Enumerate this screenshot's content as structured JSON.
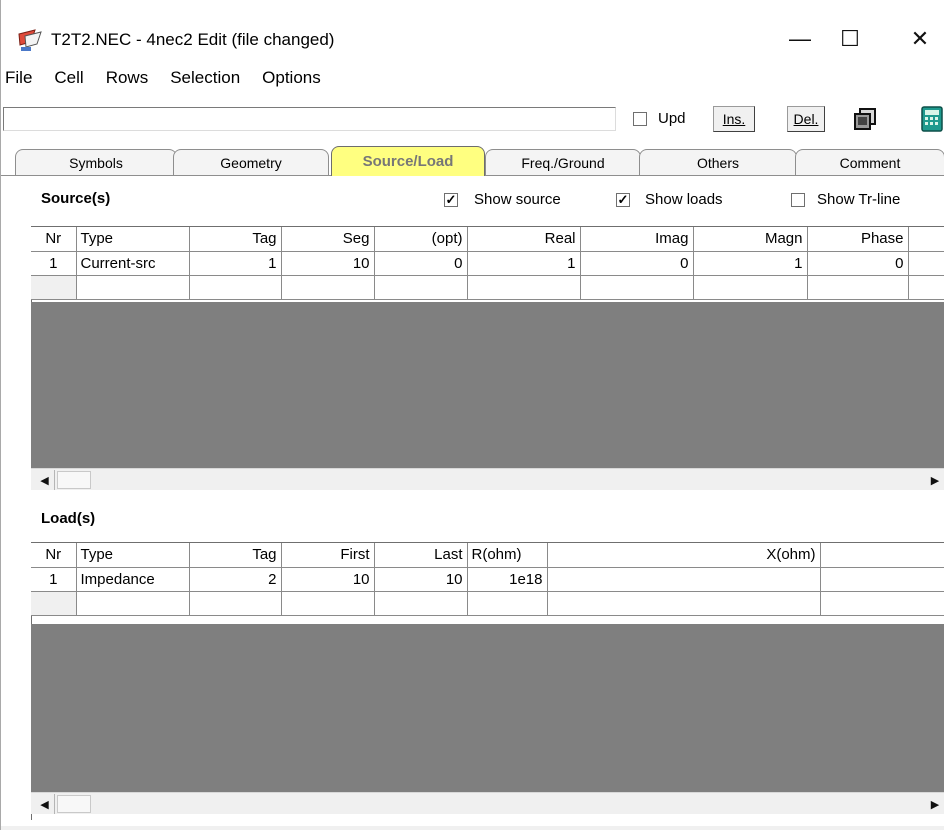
{
  "window": {
    "title": "T2T2.NEC - 4nec2 Edit (file changed)",
    "minimize_glyph": "—",
    "maximize_glyph": "☐",
    "close_glyph": "✕"
  },
  "menu": [
    "File",
    "Cell",
    "Rows",
    "Selection",
    "Options"
  ],
  "toolbar": {
    "input_value": "",
    "upd_label": "Upd",
    "upd_checked": false,
    "ins_label": "Ins.",
    "del_label": "Del."
  },
  "tabs": [
    {
      "label": "Symbols",
      "active": false
    },
    {
      "label": "Geometry",
      "active": false
    },
    {
      "label": "Source/Load",
      "active": true
    },
    {
      "label": "Freq./Ground",
      "active": false
    },
    {
      "label": "Others",
      "active": false
    },
    {
      "label": "Comment",
      "active": false
    }
  ],
  "sources": {
    "title": "Source(s)",
    "options": [
      {
        "label": "Show source",
        "checked": true
      },
      {
        "label": "Show loads",
        "checked": true
      },
      {
        "label": "Show Tr-line",
        "checked": false
      }
    ],
    "columns": [
      "Nr",
      "Type",
      "Tag",
      "Seg",
      "(opt)",
      "Real",
      "Imag",
      "Magn",
      "Phase"
    ],
    "rows": [
      [
        "1",
        "Current-src",
        "1",
        "10",
        "0",
        "1",
        "0",
        "1",
        "0"
      ]
    ]
  },
  "loads": {
    "title": "Load(s)",
    "columns": [
      "Nr",
      "Type",
      "Tag",
      "First",
      "Last",
      "R(ohm)",
      "X(ohm)"
    ],
    "rows": [
      [
        "1",
        "Impedance",
        "2",
        "10",
        "10",
        "1e18",
        ""
      ]
    ]
  },
  "colors": {
    "active_tab": "#ffff80",
    "grid_empty_area": "#7f7f7f",
    "window_bg": "#ffffff"
  },
  "icons": [
    "app-icon",
    "copy-icon",
    "calculator-icon",
    "scroll-left-arrow-icon",
    "scroll-right-arrow-icon"
  ]
}
